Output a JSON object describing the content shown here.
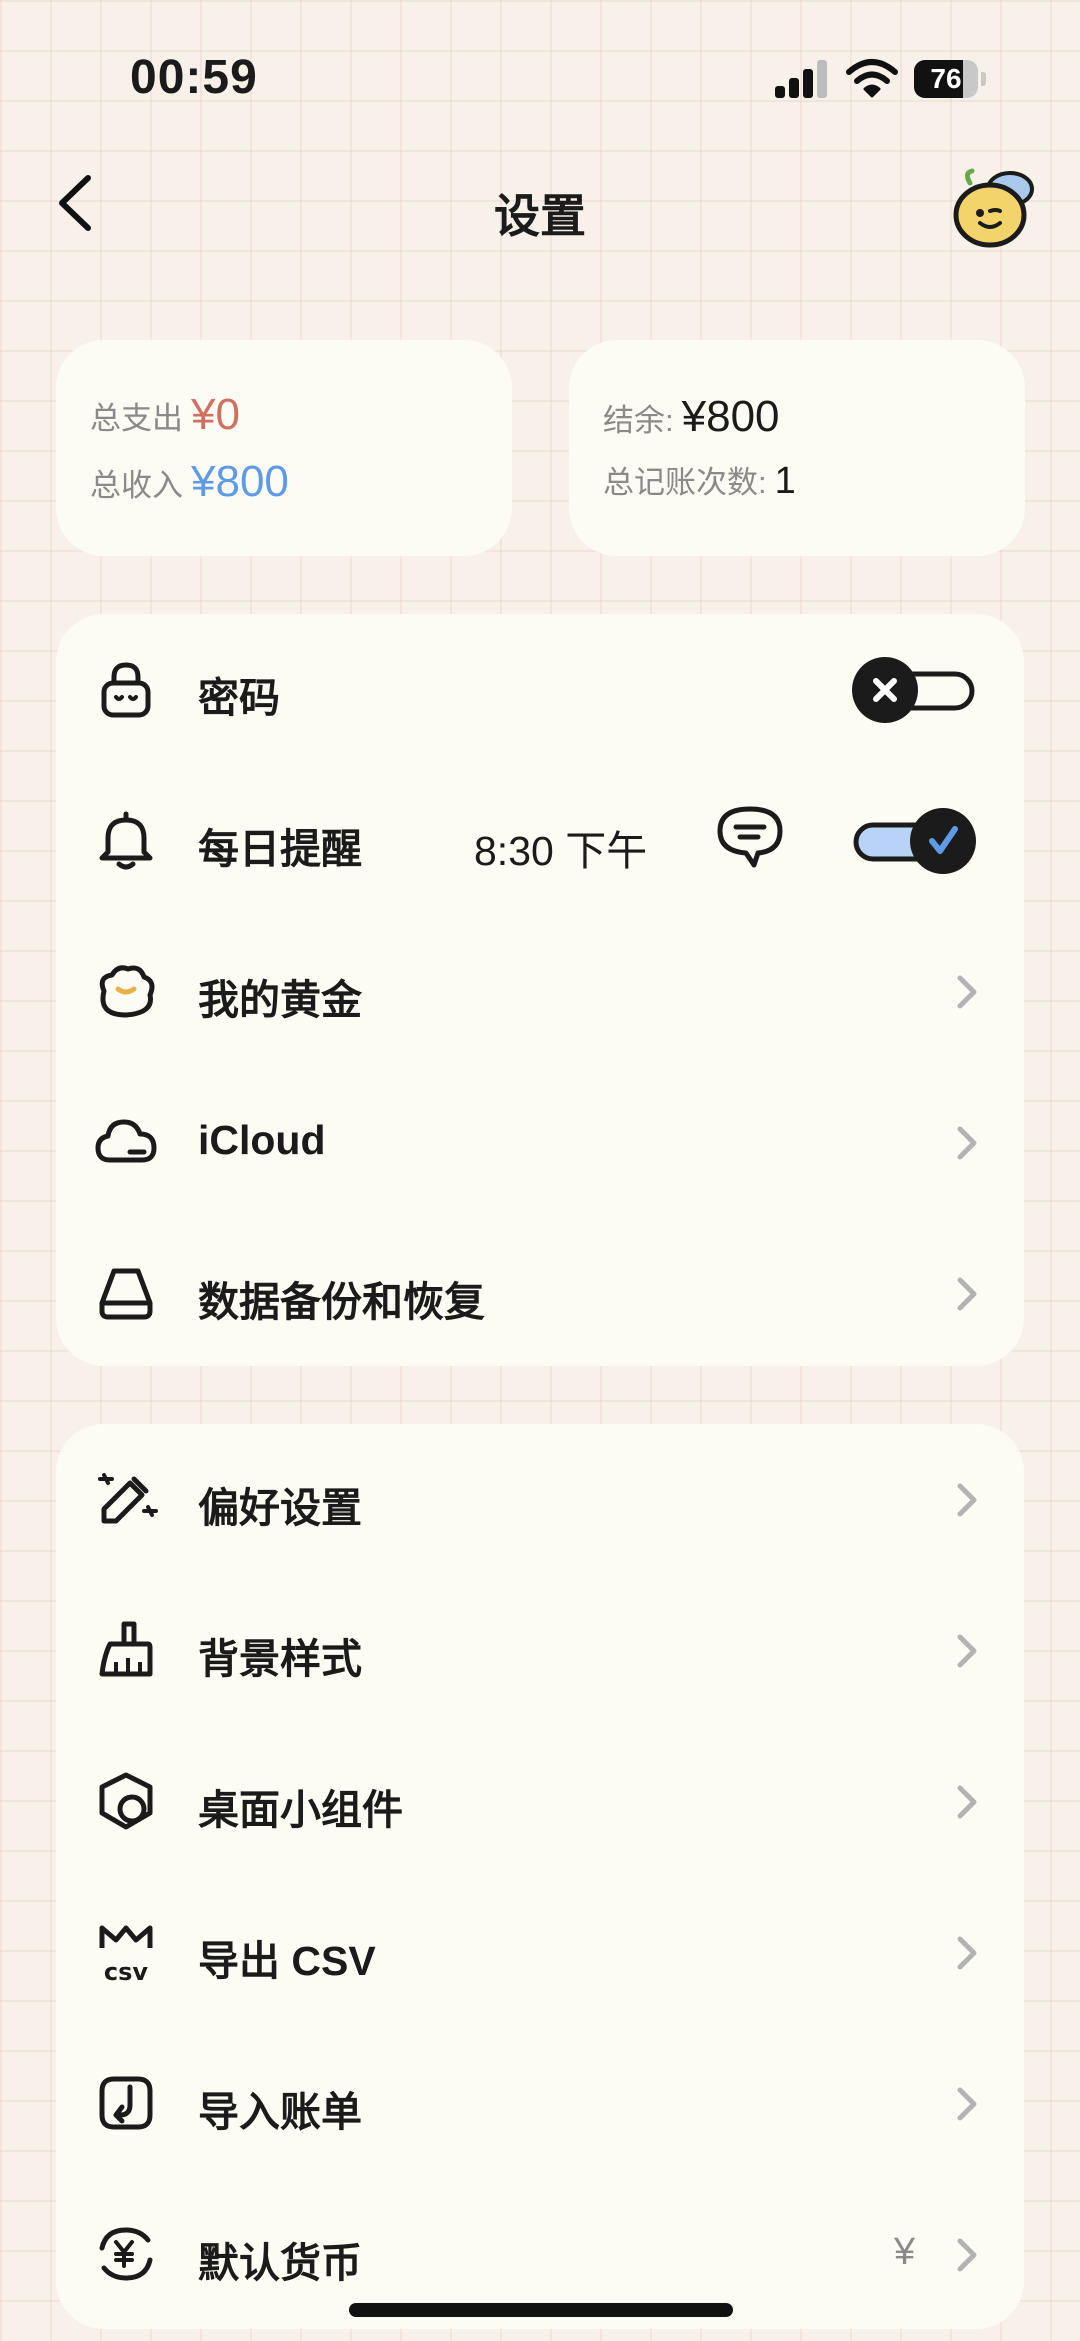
{
  "status_bar": {
    "time": "00:59",
    "battery": "76",
    "battery_level": 0.76
  },
  "header": {
    "title": "设置"
  },
  "summary": {
    "expense_label": "总支出",
    "expense_value": "¥0",
    "income_label": "总收入",
    "income_value": "¥800",
    "balance_label": "结余:",
    "balance_value": "¥800",
    "count_label": "总记账次数:",
    "count_value": "1"
  },
  "group1": {
    "password_label": "密码",
    "password_toggle": "off",
    "reminder_label": "每日提醒",
    "reminder_time": "8:30 下午",
    "reminder_toggle": "on",
    "gold_label": "我的黄金",
    "icloud_label": "iCloud",
    "backup_label": "数据备份和恢复"
  },
  "group2": {
    "preferences_label": "偏好设置",
    "background_label": "背景样式",
    "widget_label": "桌面小组件",
    "export_label": "导出 CSV",
    "import_label": "导入账单",
    "currency_label": "默认货币",
    "currency_value": "¥"
  },
  "colors": {
    "expense": "#d07062",
    "income": "#5e9ae6",
    "card": "#fdfcf4",
    "toggle_on_track": "#b8d3f5"
  }
}
